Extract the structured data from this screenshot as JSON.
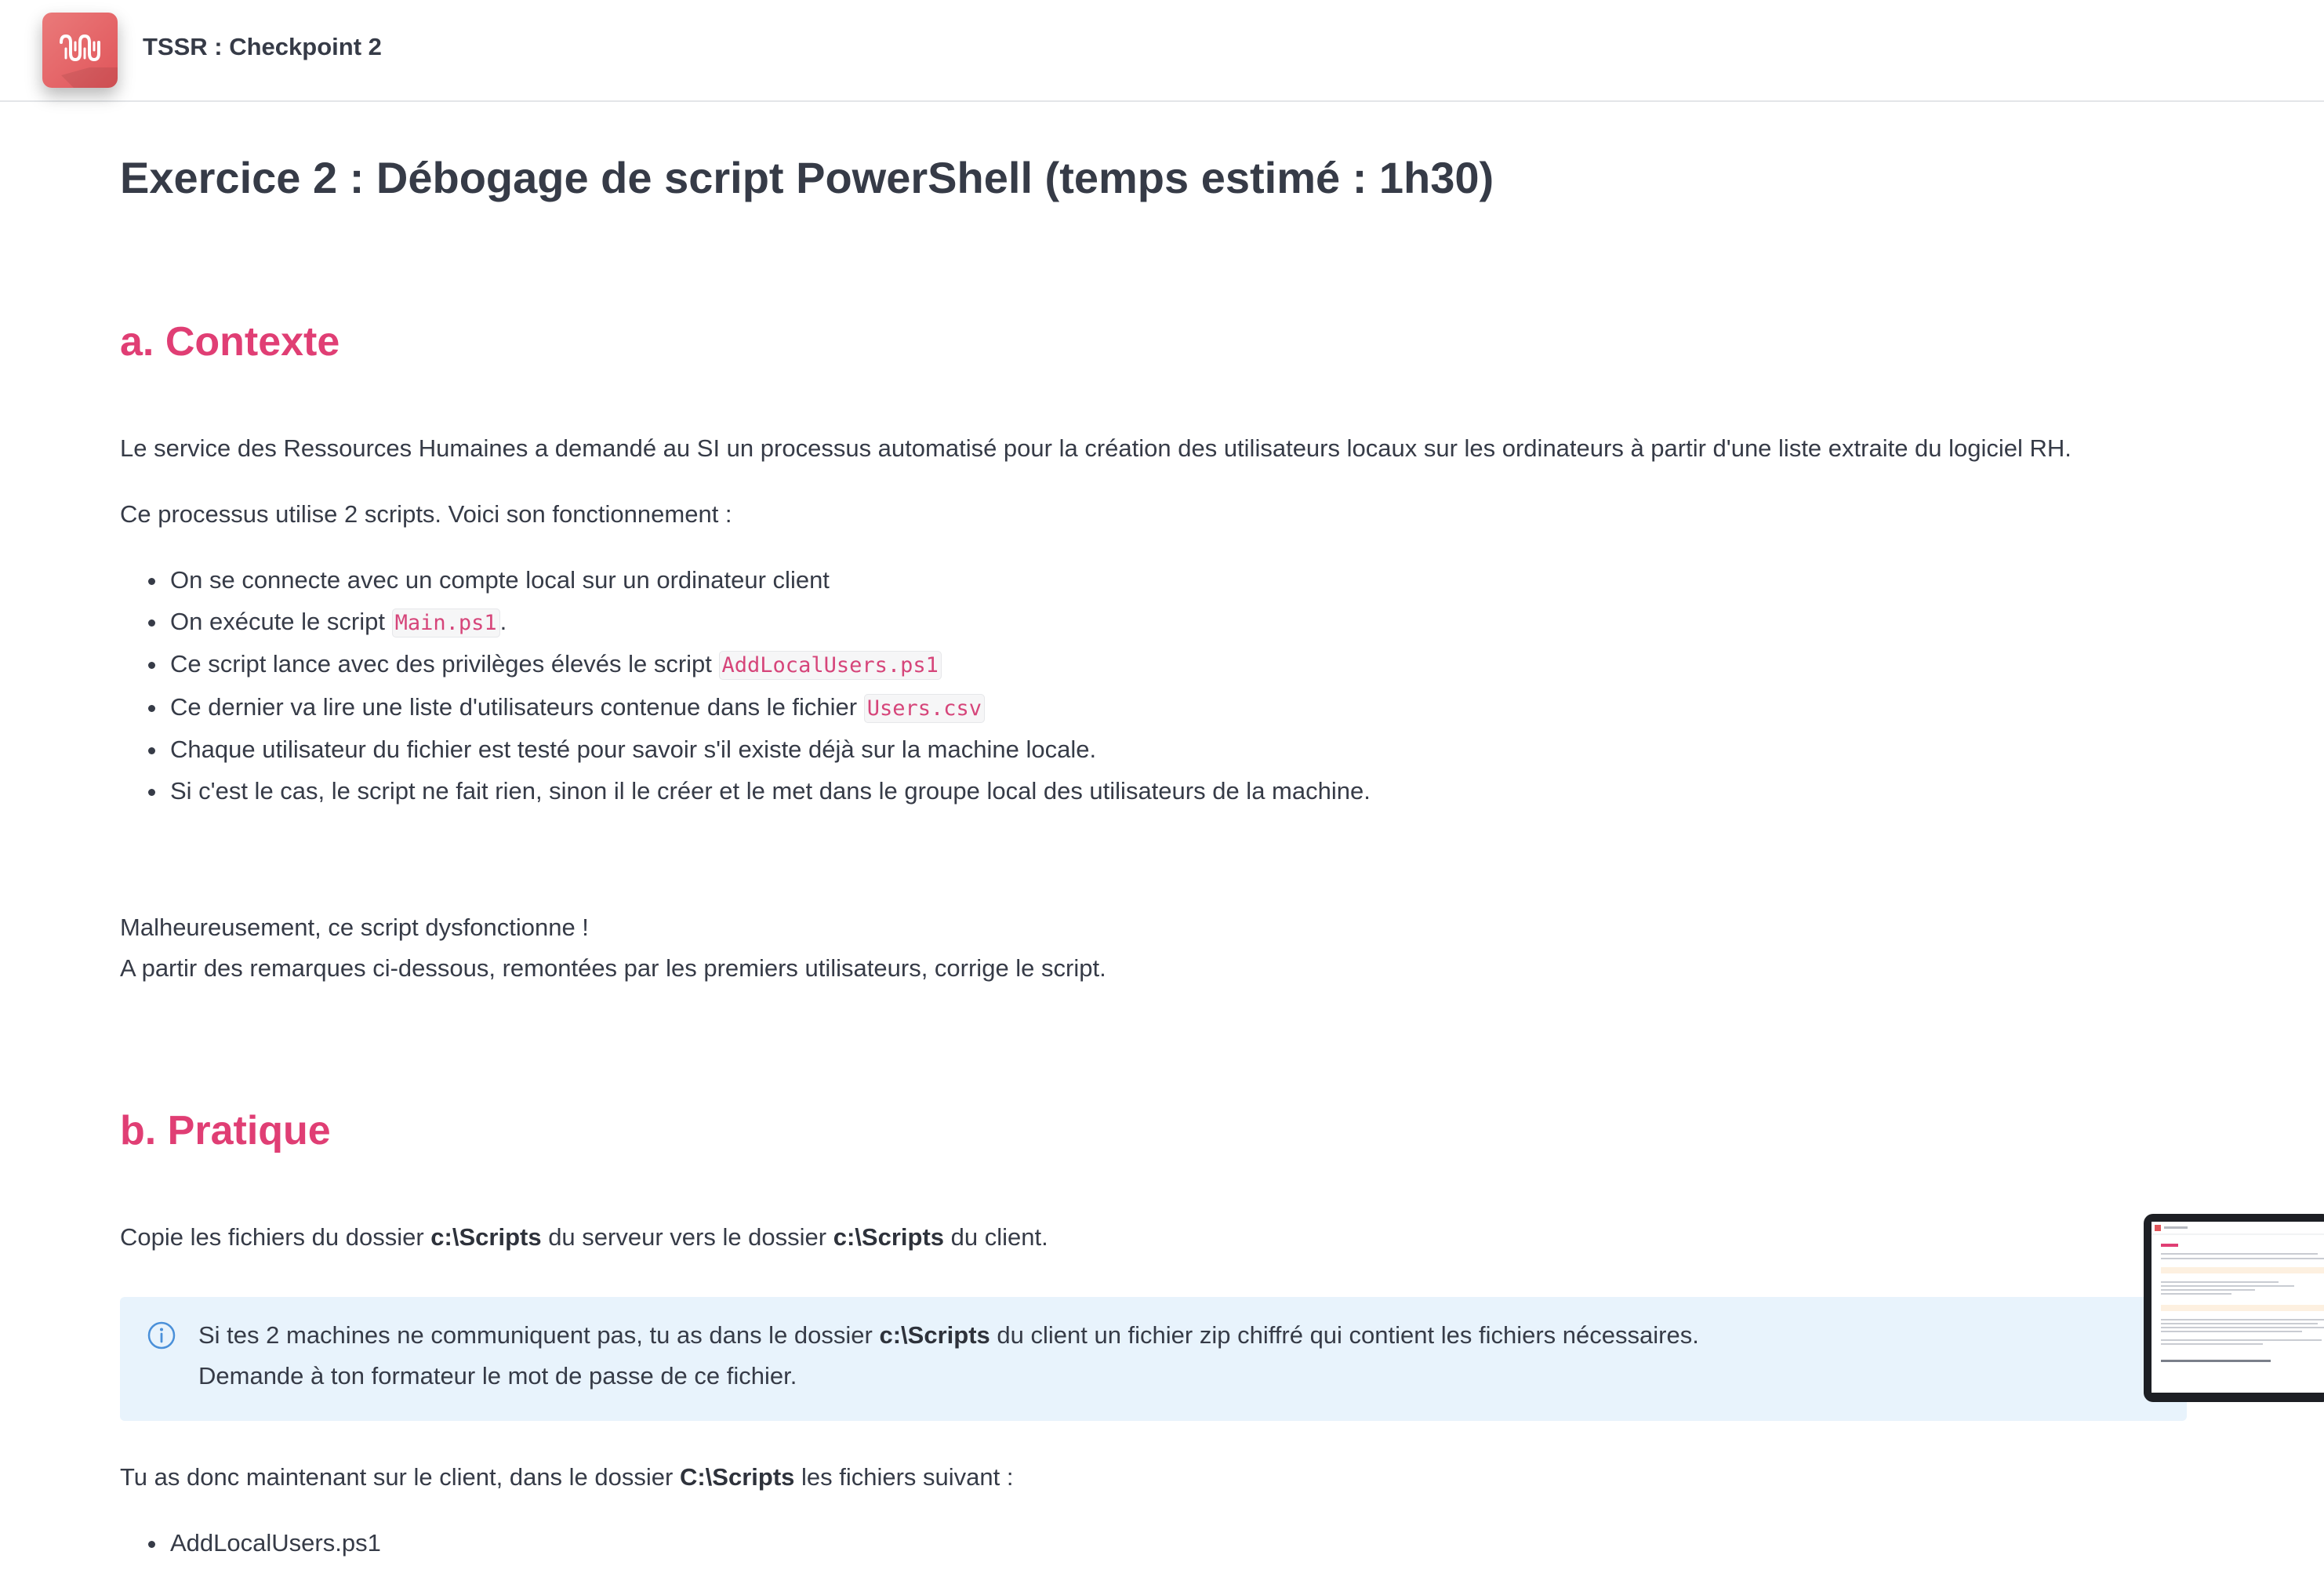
{
  "header": {
    "course_title": "TSSR : Checkpoint 2",
    "logo_icon": "course-logo-icon",
    "logo_color": "#e0555a"
  },
  "page": {
    "title": "Exercice 2 : Débogage de script PowerShell (temps estimé : 1h30)"
  },
  "section_a": {
    "heading": "a. Contexte",
    "intro": "Le service des Ressources Humaines a demandé au SI un processus automatisé pour la création des utilisateurs locaux sur les ordinateurs à partir d'une liste extraite du logiciel RH.",
    "process": "Ce processus utilise 2 scripts. Voici son fonctionnement :",
    "steps": [
      {
        "text": "On se connecte avec un compte local sur un ordinateur client"
      },
      {
        "text": "On exécute le script ",
        "code": "Main.ps1",
        "after": "."
      },
      {
        "text": "Ce script lance avec des privilèges élevés le script ",
        "code": "AddLocalUsers.ps1"
      },
      {
        "text": "Ce dernier va lire une liste d'utilisateurs contenue dans le fichier ",
        "code": "Users.csv"
      },
      {
        "text": "Chaque utilisateur du fichier est testé pour savoir s'il existe déjà sur la machine locale."
      },
      {
        "text": "Si c'est le cas, le script ne fait rien, sinon il le créer et le met dans le groupe local des utilisateurs de la machine."
      }
    ],
    "warning_line_1": "Malheureusement, ce script dysfonctionne !",
    "warning_line_2": "A partir des remarques ci-dessous, remontées par les premiers utilisateurs, corrige le script."
  },
  "section_b": {
    "heading": "b. Pratique",
    "copy_pre": "Copie les fichiers du dossier ",
    "copy_path_1": "c:\\Scripts",
    "copy_mid": " du serveur vers le dossier ",
    "copy_path_2": "c:\\Scripts",
    "copy_post": " du client.",
    "info": {
      "icon": "info-circle-icon",
      "line1_pre": "Si tes 2 machines ne communiquent pas, tu as dans le dossier ",
      "line1_path": "c:\\Scripts",
      "line1_post": " du client un fichier zip chiffré qui contient les fichiers nécessaires.",
      "line2": "Demande à ton formateur le mot de passe de ce fichier."
    },
    "files_pre": "Tu as donc maintenant sur le client, dans le dossier ",
    "files_path": "C:\\Scripts",
    "files_post": " les fichiers suivant :",
    "files": [
      "AddLocalUsers.ps1"
    ]
  },
  "colors": {
    "heading_accent": "#e03e74",
    "text": "#363b47",
    "info_background": "#e8f3fc",
    "info_icon": "#4a90d9",
    "code_text": "#d6457a"
  }
}
